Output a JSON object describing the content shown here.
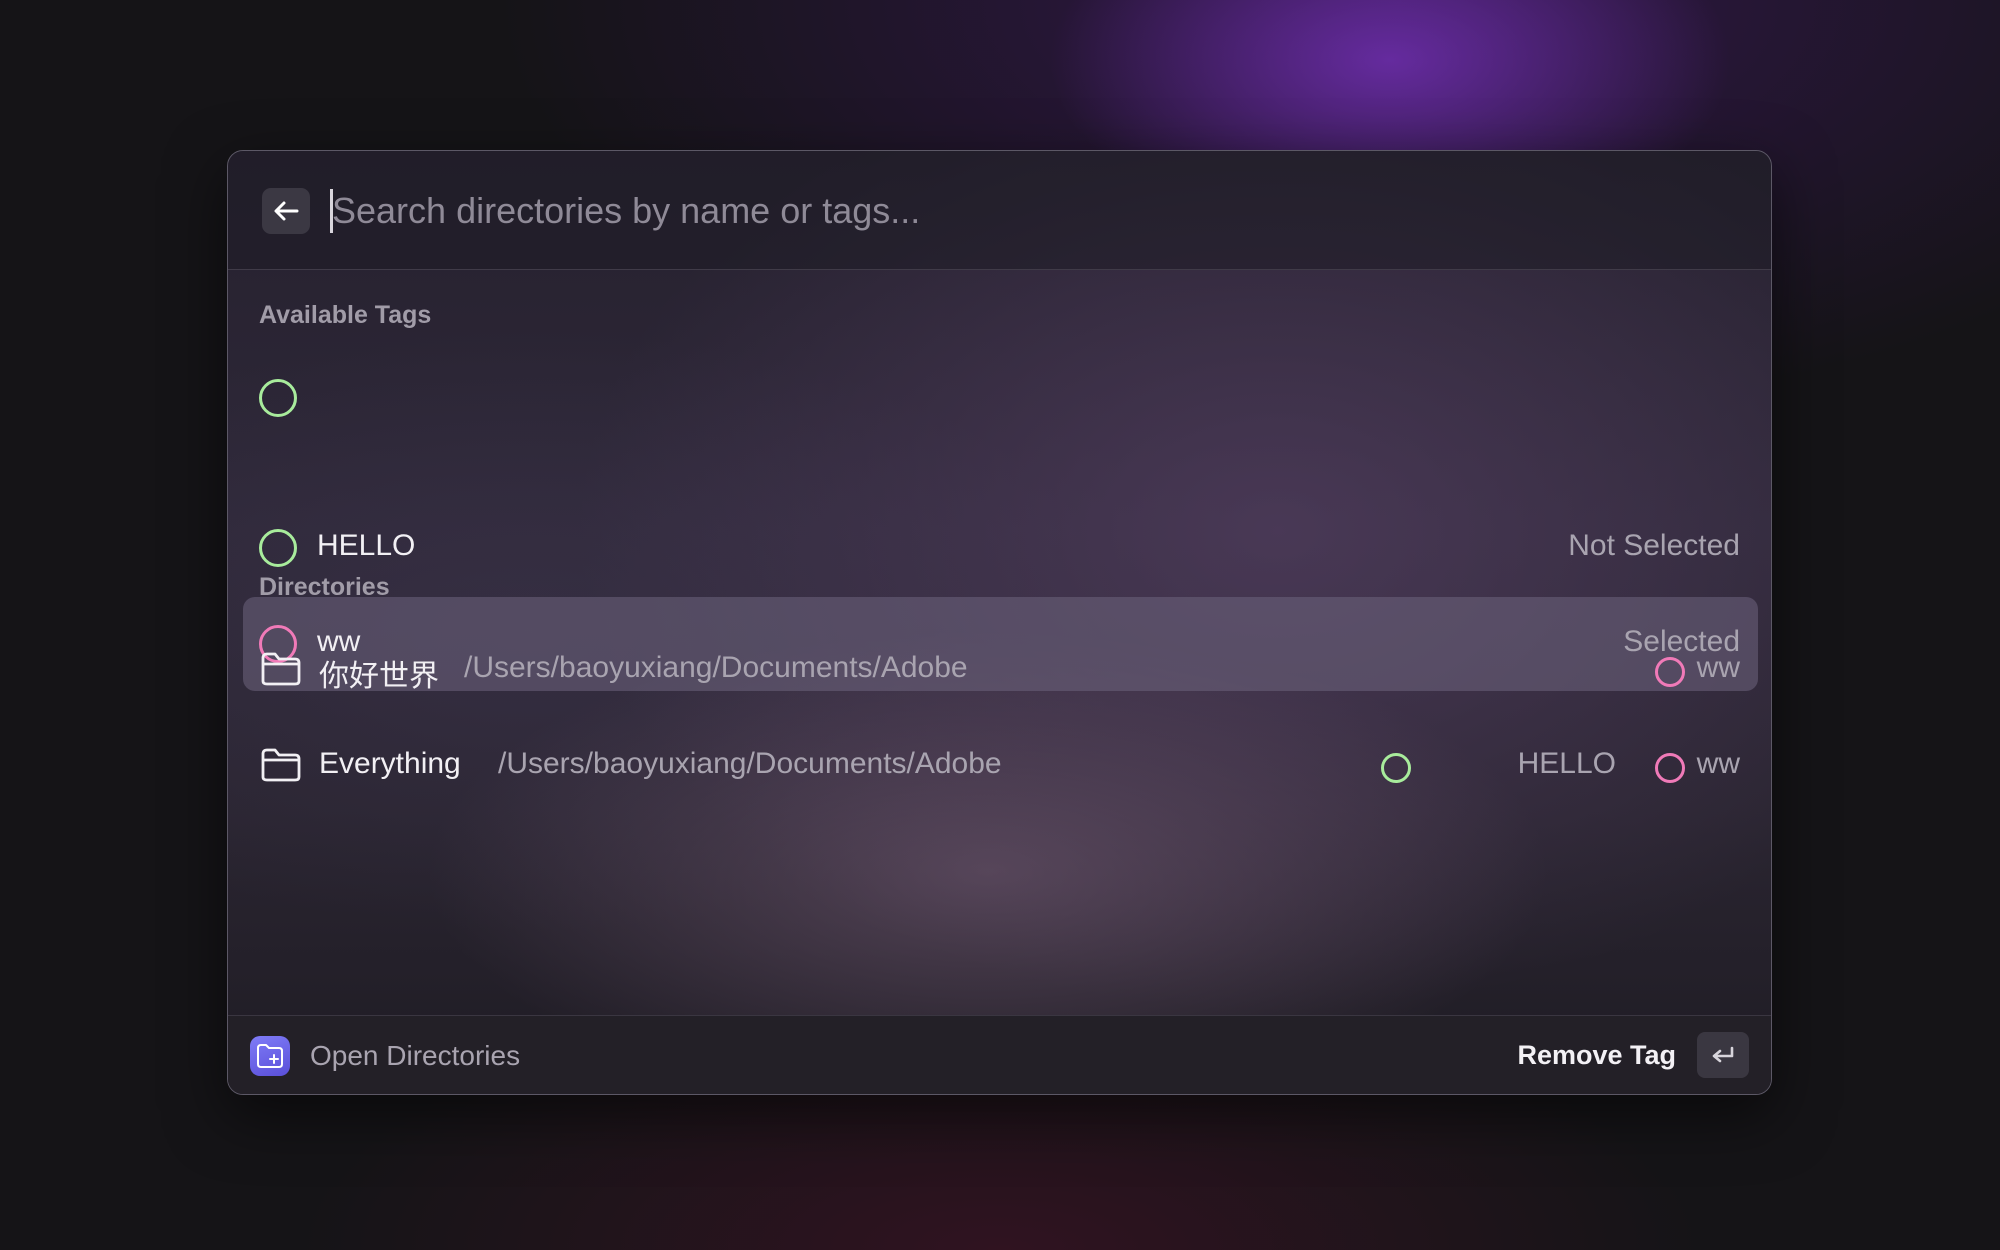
{
  "search": {
    "placeholder": "Search directories by name or tags...",
    "value": ""
  },
  "tags_section": {
    "header": "Available Tags",
    "items": [
      {
        "name": "HELLO",
        "status": "Not Selected",
        "color": "#a8ec9c",
        "highlighted": false
      },
      {
        "name": "ww",
        "status": "Selected",
        "color": "#f07ab8",
        "highlighted": true
      }
    ]
  },
  "directories_section": {
    "header": "Directories",
    "items": [
      {
        "name": "你好世界",
        "path": "/Users/baoyuxiang/Documents/Adobe",
        "tags": [
          {
            "name": "ww",
            "color": "#f07ab8"
          }
        ]
      },
      {
        "name": "Everything",
        "path": "/Users/baoyuxiang/Documents/Adobe",
        "tags": [
          {
            "name": "HELLO",
            "color": "#a8ec9c"
          },
          {
            "name": "ww",
            "color": "#f07ab8"
          }
        ]
      }
    ]
  },
  "footer": {
    "title": "Open Directories",
    "action": "Remove Tag",
    "app_icon": "folder-add-icon",
    "action_key_icon": "enter-key-icon"
  },
  "colors": {
    "tag_hello": "#a8ec9c",
    "tag_ww": "#f07ab8",
    "app_icon_accent": "#6e66ee"
  }
}
